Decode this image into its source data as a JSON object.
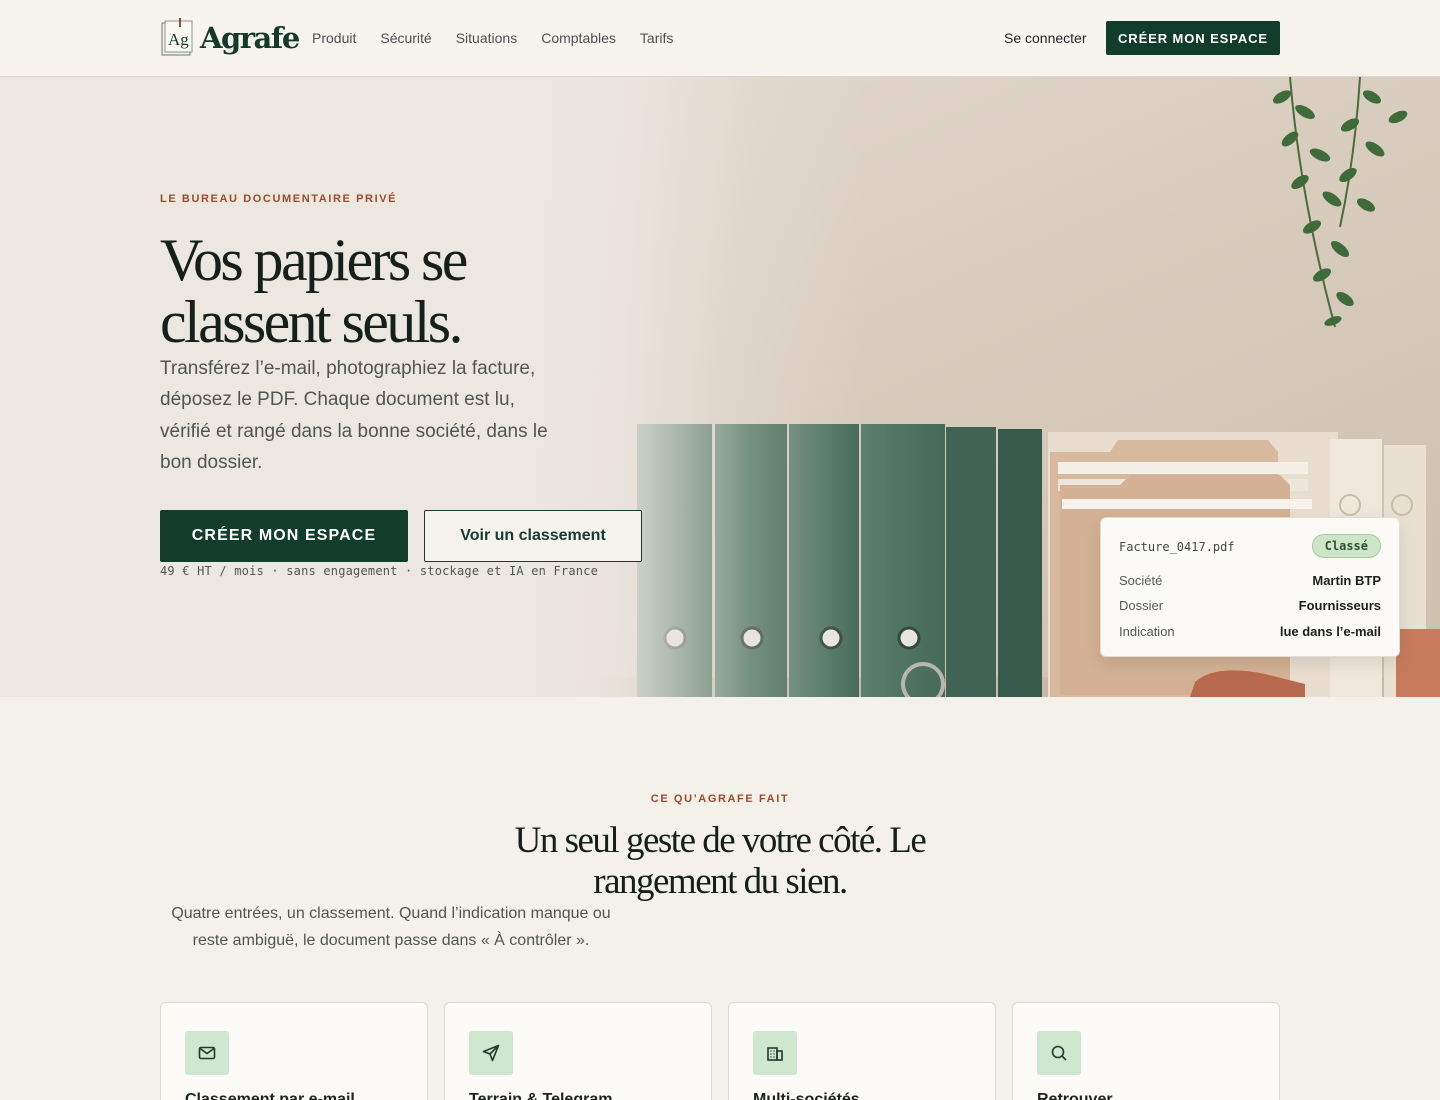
{
  "brand": {
    "name": "Agrafe",
    "mark_text": "Ag"
  },
  "nav": {
    "items": [
      "Produit",
      "Sécurité",
      "Situations",
      "Comptables",
      "Tarifs"
    ],
    "login": "Se connecter",
    "cta": "CRÉER MON ESPACE"
  },
  "hero": {
    "eyebrow": "LE BUREAU DOCUMENTAIRE PRIVÉ",
    "title": "Vos papiers se classent seuls.",
    "subtitle": "Transférez l’e-mail, photographiez la facture, déposez le PDF. Chaque document est lu, vérifié et rangé dans la bonne société, dans le bon dossier.",
    "primary_cta": "CRÉER MON ESPACE",
    "secondary_cta": "Voir un classement",
    "price_note": "49 € HT / mois · sans engagement · stockage et IA en France"
  },
  "doc_card": {
    "filename": "Facture_0417.pdf",
    "status": "Classé",
    "rows": [
      {
        "label": "Société",
        "value": "Martin BTP"
      },
      {
        "label": "Dossier",
        "value": "Fournisseurs"
      },
      {
        "label": "Indication",
        "value": "lue dans l’e-mail"
      }
    ]
  },
  "features": {
    "eyebrow": "CE QU’AGRAFE FAIT",
    "title": "Un seul geste de votre côté. Le rangement du sien.",
    "subtitle": "Quatre entrées, un classement. Quand l’indication manque ou reste ambiguë, le document passe dans « À contrôler ».",
    "cards": [
      {
        "icon": "mail-icon",
        "title": "Classement par e-mail"
      },
      {
        "icon": "send-icon",
        "title": "Terrain & Telegram"
      },
      {
        "icon": "building-icon",
        "title": "Multi-sociétés"
      },
      {
        "icon": "search-icon",
        "title": "Retrouver"
      }
    ]
  },
  "colors": {
    "brand_green": "#123d2c",
    "accent_rust": "#9a4b2d",
    "badge_green": "#cfe5c9",
    "page_bg": "#f4f1ea"
  }
}
